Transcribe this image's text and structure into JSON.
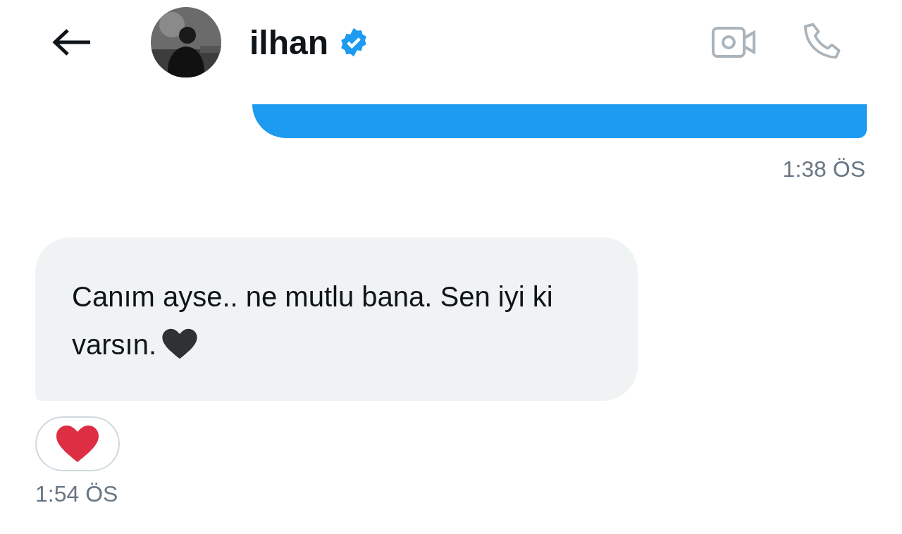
{
  "header": {
    "name": "ilhan",
    "verified": true
  },
  "messages": [
    {
      "kind": "sent",
      "time": "1:38 ÖS"
    },
    {
      "kind": "received",
      "text": "Canım ayse.. ne mutlu bana. Sen iyi ki varsın.",
      "reaction": true,
      "time": "1:54 ÖS"
    }
  ]
}
